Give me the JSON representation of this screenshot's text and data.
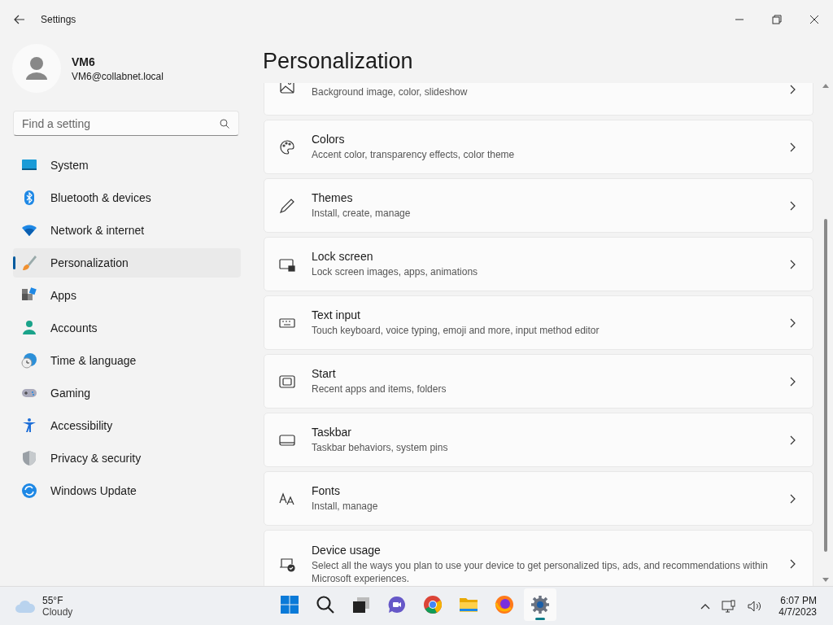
{
  "window": {
    "title": "Settings"
  },
  "user": {
    "name": "VM6",
    "email": "VM6@collabnet.local"
  },
  "search": {
    "placeholder": "Find a setting"
  },
  "sidebar": {
    "items": [
      {
        "label": "System",
        "selected": false
      },
      {
        "label": "Bluetooth & devices",
        "selected": false
      },
      {
        "label": "Network & internet",
        "selected": false
      },
      {
        "label": "Personalization",
        "selected": true
      },
      {
        "label": "Apps",
        "selected": false
      },
      {
        "label": "Accounts",
        "selected": false
      },
      {
        "label": "Time & language",
        "selected": false
      },
      {
        "label": "Gaming",
        "selected": false
      },
      {
        "label": "Accessibility",
        "selected": false
      },
      {
        "label": "Privacy & security",
        "selected": false
      },
      {
        "label": "Windows Update",
        "selected": false
      }
    ]
  },
  "page": {
    "title": "Personalization",
    "cards": [
      {
        "subtitle": "Background image, color, slideshow"
      },
      {
        "title": "Colors",
        "subtitle": "Accent color, transparency effects, color theme"
      },
      {
        "title": "Themes",
        "subtitle": "Install, create, manage"
      },
      {
        "title": "Lock screen",
        "subtitle": "Lock screen images, apps, animations"
      },
      {
        "title": "Text input",
        "subtitle": "Touch keyboard, voice typing, emoji and more, input method editor"
      },
      {
        "title": "Start",
        "subtitle": "Recent apps and items, folders"
      },
      {
        "title": "Taskbar",
        "subtitle": "Taskbar behaviors, system pins"
      },
      {
        "title": "Fonts",
        "subtitle": "Install, manage"
      },
      {
        "title": "Device usage",
        "subtitle": "Select all the ways you plan to use your device to get personalized tips, ads, and recommendations within Microsoft experiences."
      }
    ]
  },
  "taskbar": {
    "weather": {
      "temperature": "55°F",
      "condition": "Cloudy"
    },
    "apps": [
      {
        "selected": false
      },
      {
        "selected": false
      },
      {
        "selected": false
      },
      {
        "selected": false
      },
      {
        "selected": false
      },
      {
        "selected": false
      },
      {
        "selected": false
      },
      {
        "selected": true
      }
    ],
    "time": "6:07 PM",
    "date": "4/7/2023"
  }
}
